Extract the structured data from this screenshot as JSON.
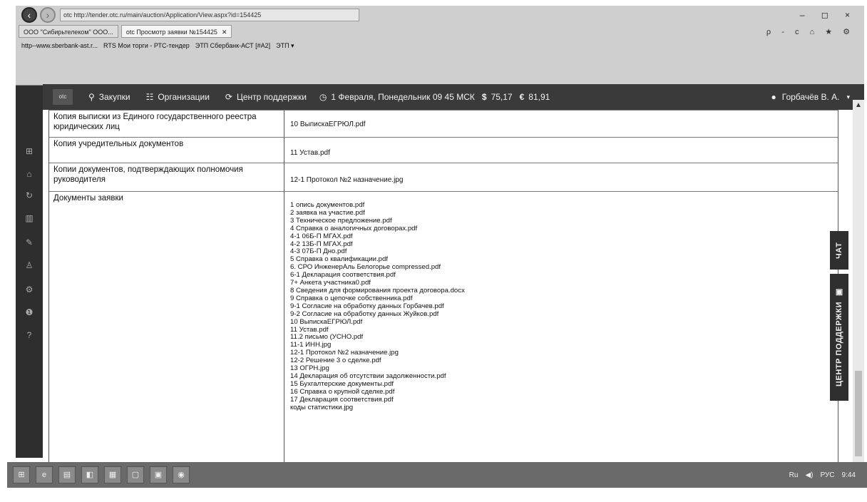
{
  "browser": {
    "back_icon": "back-arrow-icon",
    "forward_icon": "forward-arrow-icon",
    "url": "otc http://tender.otc.ru/main/auction/Application/View.aspx?id=154425",
    "window_controls": "– ◻ ×",
    "tabs": [
      {
        "label": "ООО \"Сибирьтелеком\" ООО..."
      },
      {
        "label": "otc Просмотр заявки №154425"
      }
    ],
    "tab_tools": "ρ - c  ⌂ ★ ⚙",
    "favorites": [
      {
        "label": "http--www.sberbank-ast.r..."
      },
      {
        "label": "RTS Мои торги - РТС-тендер"
      },
      {
        "label": "ЭТП Сбербанк-АСТ [#A2]"
      },
      {
        "label": "ЭТП ▾"
      }
    ]
  },
  "site_nav": {
    "logo": "otc",
    "links": [
      {
        "label": "Закупки",
        "icon": "search-icon"
      },
      {
        "label": "Организации",
        "icon": "people-icon"
      },
      {
        "label": "Центр поддержки",
        "icon": "support-icon"
      }
    ],
    "date_text": "1 Февраля, Понедельник 09 45 МСК",
    "usd_symbol": "$",
    "usd_rate": "75,17",
    "eur_symbol": "€",
    "eur_rate": "81,91",
    "user_name": "Горбачёв В. А."
  },
  "table": {
    "rows": [
      {
        "label": "Копия выписки из Единого государственного реестра юридических лиц",
        "value": "10 ВыпискаЕГРЮЛ.pdf"
      },
      {
        "label": "Копия учредительных документов",
        "value": "11 Устав.pdf"
      },
      {
        "label": "Копии документов, подтверждающих полномочия руководителя",
        "value": "12-1 Протокол №2 назначение.jpg"
      }
    ],
    "docs_label": "Документы заявки",
    "docs": [
      "1 опись документов.pdf",
      "2 заявка на участие.pdf",
      "3 Техническое предложение.pdf",
      "4 Справка о аналогичных договорах.pdf",
      "4-1 06Б-П МГАХ.pdf",
      "4-2 13Б-П МГАХ.pdf",
      "4-3 07Б-П Дно.pdf",
      "5 Справка о квалификации.pdf",
      "6. СРО ИнженерАль Белогорье compressed.pdf",
      "6-1 Декларация соответствия.pdf",
      "7+ Анкета участника0.pdf",
      "8 Сведения для формирования проекта договора.docx",
      "9 Справка о цепочке собственника.pdf",
      "9-1 Согласие на обработку данных Горбачев.pdf",
      "9-2 Согласие на обработку данных Жуйков.pdf",
      "10 ВыпискаЕГРЮЛ.pdf",
      "11 Устав.pdf",
      "11.2 письмо (УСНО.pdf",
      "11-1 ИНН.jpg",
      "12-1 Протокол №2 назначение.jpg",
      "12-2 Решение 3 о сделке.pdf",
      "13 ОГРН.jpg",
      "14 Декларация об отсутствии задолженности.pdf",
      "15 Бухгалтерские документы.pdf",
      "16 Справка о крупной сделке.pdf",
      "17 Декларация соответствия.pdf",
      "коды статистики.jpg"
    ]
  },
  "side_tabs": {
    "chat": "ЧАТ",
    "support": "ЦЕНТР ПОДДЕРЖКИ"
  },
  "taskbar": {
    "lang": "Ru",
    "kb": "РУС",
    "time": "9:44"
  }
}
